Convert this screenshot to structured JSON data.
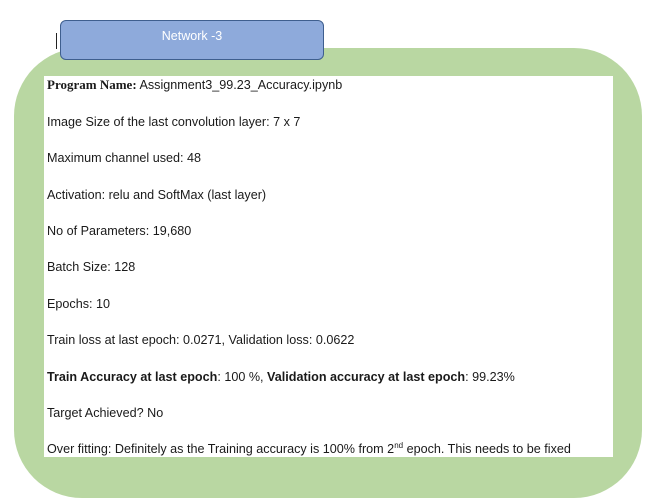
{
  "header": {
    "title": "Network -3"
  },
  "fields": {
    "program_label": "Program Name:",
    "program_value": " Assignment3_99.23_Accuracy.ipynb",
    "image_size": "Image Size of the last convolution layer: 7 x 7",
    "max_channel": "Maximum channel used: 48",
    "activation": "Activation: relu and SoftMax (last layer)",
    "params": "No of Parameters: 19,680",
    "batch": "Batch Size: 128",
    "epochs": "Epochs: 10",
    "loss": "Train loss at last epoch: 0.0271, Validation loss: 0.0622",
    "train_acc_label": "Train Accuracy at last epoch",
    "train_acc_value": ": 100 %, ",
    "val_acc_label": "Validation accuracy at last epoch",
    "val_acc_value": ": 99.23%",
    "target": "Target Achieved? No",
    "overfit_pre": "Over fitting: Definitely as the Training accuracy is 100% from 2",
    "overfit_sup": "nd",
    "overfit_post": " epoch. This needs to be fixed"
  },
  "colors": {
    "frame": "#b9d7a2",
    "title_box": "#8eaadb",
    "title_border": "#3f5f8f"
  }
}
